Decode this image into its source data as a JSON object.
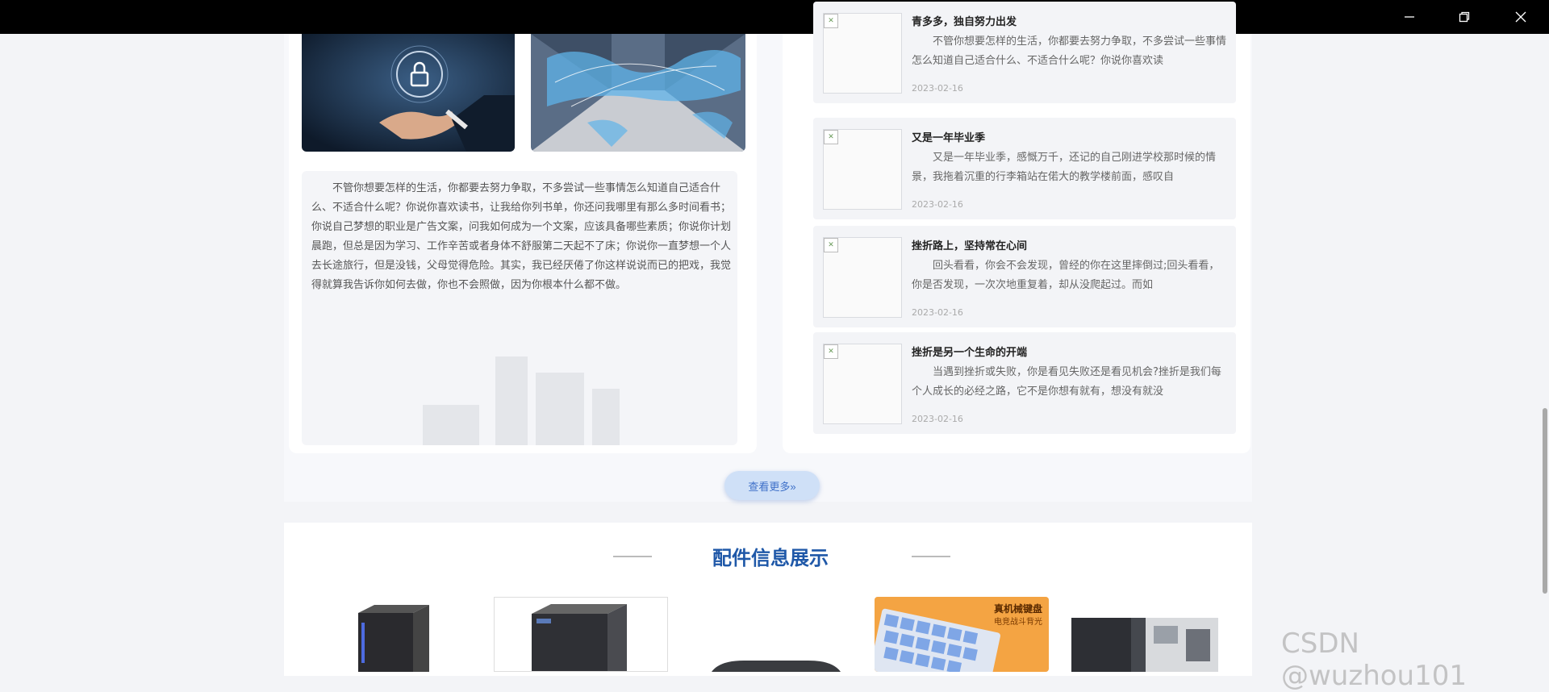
{
  "window": {
    "buttons": [
      "minimize",
      "restore",
      "close"
    ]
  },
  "intro": {
    "text": "不管你想要怎样的生活，你都要去努力争取，不多尝试一些事情怎么知道自己适合什么、不适合什么呢？你说你喜欢读书，让我给你列书单，你还问我哪里有那么多时间看书；你说自己梦想的职业是广告文案，问我如何成为一个文案，应该具备哪些素质；你说你计划晨跑，但总是因为学习、工作辛苦或者身体不舒服第二天起不了床；你说你一直梦想一个人去长途旅行，但是没钱，父母觉得危险。其实，我已经厌倦了你这样说说而已的把戏，我觉得就算我告诉你如何去做，你也不会照做，因为你根本什么都不做。"
  },
  "news": [
    {
      "title": "青多多，独自努力出发",
      "text": "不管你想要怎样的生活，你都要去努力争取，不多尝试一些事情怎么知道自己适合什么、不适合什么呢？你说你喜欢读",
      "date": "2023-02-16"
    },
    {
      "title": "又是一年毕业季",
      "text": "又是一年毕业季，感慨万千，还记的自己刚进学校那时候的情景，我拖着沉重的行李箱站在偌大的教学楼前面，感叹自",
      "date": "2023-02-16"
    },
    {
      "title": "挫折路上，坚持常在心间",
      "text": "回头看看，你会不会发现，曾经的你在这里摔倒过;回头看看，你是否发现，一次次地重复着，却从没爬起过。而如",
      "date": "2023-02-16"
    },
    {
      "title": "挫折是另一个生命的开端",
      "text": "当遇到挫折或失败，你是看见失败还是看见机会?挫折是我们每个人成长的必经之路，它不是你想有就有，想没有就没",
      "date": "2023-02-16"
    }
  ],
  "more_button": "查看更多»",
  "section": {
    "title": "配件信息展示"
  },
  "products": [
    {
      "name": "pc-case"
    },
    {
      "name": "pc-case"
    },
    {
      "name": "mouse"
    },
    {
      "name": "keyboard",
      "banner": "真机械键盘",
      "banner_sub": "电竞战斗背光"
    },
    {
      "name": "open-pc-case"
    }
  ],
  "watermark": "CSDN @wuzhou101",
  "colors": {
    "accent": "#1f58a8",
    "button_bg": "#cfe0f7",
    "titlebar": "#000000"
  }
}
